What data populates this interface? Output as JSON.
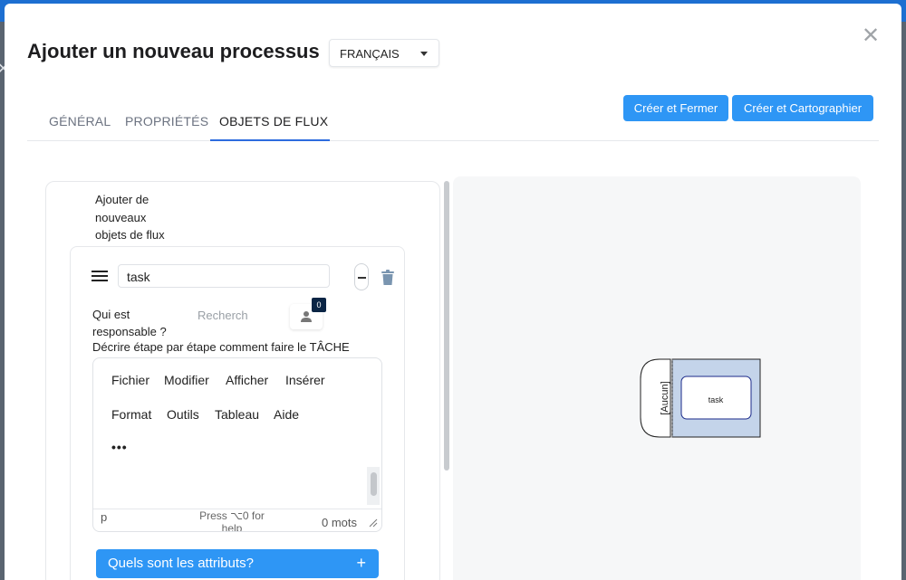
{
  "modal": {
    "title": "Ajouter un nouveau processus",
    "language": "FRANÇAIS",
    "close_icon": "close-icon"
  },
  "tabs": [
    {
      "label": "GÉNÉRAL",
      "active": false
    },
    {
      "label": "PROPRIÉTÉS",
      "active": false
    },
    {
      "label": "OBJETS DE FLUX",
      "active": true
    }
  ],
  "actions": {
    "create_close": "Créer et Fermer",
    "create_map": "Créer et Cartographier"
  },
  "flow_panel": {
    "add_label": "Ajouter de nouveaux objets de flux",
    "item": {
      "name": "task",
      "responsible_label": "Qui est responsable ?",
      "search_placeholder": "Recherch",
      "user_count": "0",
      "describe_label": "Décrire étape par étape comment faire le TÂCHE",
      "editor": {
        "menu": [
          "Fichier",
          "Modifier",
          "Afficher",
          "Insérer",
          "Format",
          "Outils",
          "Tableau",
          "Aide"
        ],
        "more": "•••",
        "status_path": "p",
        "status_hint": "Press ⌥0 for help",
        "word_count": "0 mots"
      },
      "attributes_button": "Quels sont les attributs?",
      "attributes_plus": "+"
    }
  },
  "diagram": {
    "lane_label": "[Aucun]",
    "task_label": "task",
    "lane_color": "#c4d4ea"
  }
}
